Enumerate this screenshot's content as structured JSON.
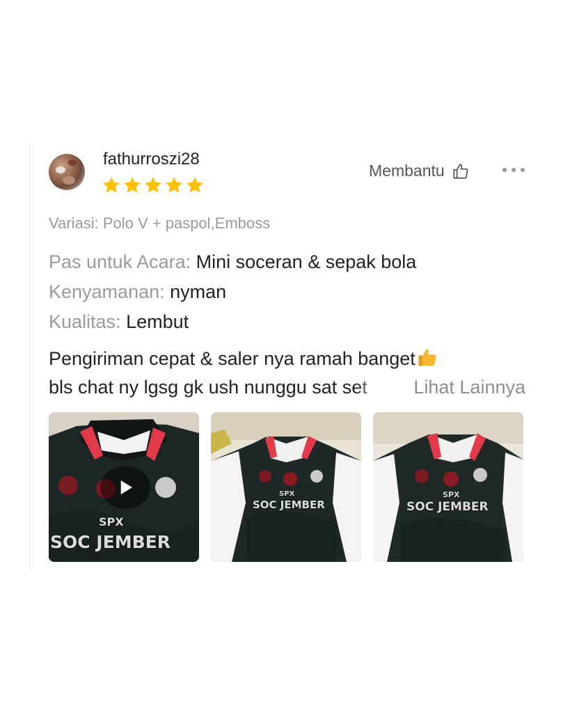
{
  "review": {
    "username": "fathurroszi28",
    "rating": 5,
    "helpful_label": "Membantu",
    "variation": "Variasi: Polo V + paspol,Emboss",
    "attributes": [
      {
        "key": "Pas untuk Acara:",
        "value": "Mini soceran & sepak bola"
      },
      {
        "key": "Kenyamanan:",
        "value": "nyman"
      },
      {
        "key": "Kualitas:",
        "value": "Lembut"
      }
    ],
    "text_line1": "Pengiriman cepat & saler nya ramah banget",
    "text_line2": "bls chat ny lgsg gk ush nunggu sat set",
    "see_more": "Lihat Lainnya",
    "photos": [
      {
        "kind": "video",
        "brand": "SPX",
        "name": "SOC JEMBER"
      },
      {
        "kind": "image",
        "brand": "SPX",
        "name": "SOC JEMBER"
      },
      {
        "kind": "image",
        "brand": "SPX",
        "name": "SOC JEMBER"
      }
    ]
  },
  "colors": {
    "star": "#FFC107",
    "muted_text": "#9a9a9a",
    "body_text": "#222222",
    "thumb_emoji": "#F5B630"
  },
  "icons": {
    "helpful": "thumbs-up-outline-icon",
    "more": "more-dots-icon",
    "play": "play-icon",
    "emoji": "thumbs-up-emoji-icon"
  }
}
